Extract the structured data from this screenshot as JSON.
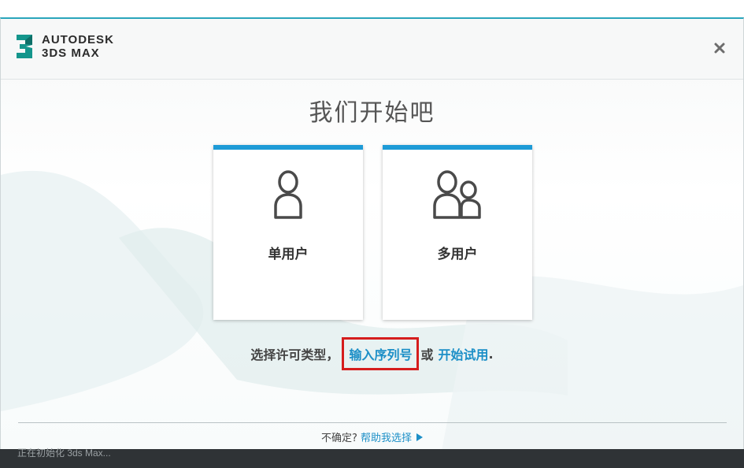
{
  "app": {
    "brand_line1": "AUTODESK",
    "brand_line2": "3DS MAX",
    "logo_digit": "3",
    "accent_color": "#1e9bd7",
    "header_accent_color": "#2aa5bb"
  },
  "header": {
    "close_icon": "close-icon"
  },
  "main": {
    "title": "我们开始吧",
    "cards": [
      {
        "label": "单用户",
        "icon": "single-user-icon"
      },
      {
        "label": "多用户",
        "icon": "multi-user-icon"
      }
    ],
    "license_prefix": "选择许可类型，",
    "serial_link": "输入序列号",
    "or_text": "或",
    "trial_link": "开始试用",
    "suffix": ".",
    "highlight_color": "#d51d1d"
  },
  "footer": {
    "question": "不确定?",
    "help_link": "帮助我选择",
    "arrow_icon": "triangle-right-icon"
  },
  "taskbar": {
    "status_text": "正在初始化 3ds Max..."
  }
}
